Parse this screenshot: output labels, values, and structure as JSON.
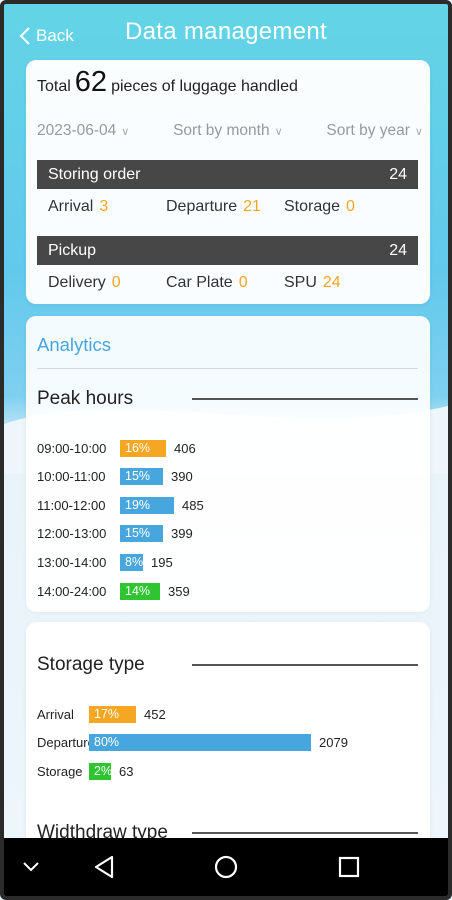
{
  "header": {
    "back_label": "Back",
    "title": "Data management"
  },
  "summary": {
    "total_prefix": "Total",
    "total_count": "62",
    "total_suffix": "pieces of luggage handled",
    "filters": {
      "date": "2023-06-04",
      "month": "Sort by month",
      "year": "Sort by year"
    },
    "storing_order": {
      "label": "Storing order",
      "count": "24",
      "stats": [
        {
          "label": "Arrival",
          "value": "3"
        },
        {
          "label": "Departure",
          "value": "21"
        },
        {
          "label": "Storage",
          "value": "0"
        }
      ]
    },
    "pickup": {
      "label": "Pickup",
      "count": "24",
      "stats": [
        {
          "label": "Delivery",
          "value": "0"
        },
        {
          "label": "Car Plate",
          "value": "0"
        },
        {
          "label": "SPU",
          "value": "24"
        }
      ]
    }
  },
  "analytics": {
    "heading": "Analytics",
    "peak_hours": {
      "title": "Peak hours",
      "rows": [
        {
          "label": "09:00-10:00",
          "percent": "16%",
          "fraction": 0.16,
          "value": "406",
          "color": "#f5a623"
        },
        {
          "label": "10:00-11:00",
          "percent": "15%",
          "fraction": 0.15,
          "value": "390",
          "color": "#47a6de"
        },
        {
          "label": "11:00-12:00",
          "percent": "19%",
          "fraction": 0.19,
          "value": "485",
          "color": "#47a6de"
        },
        {
          "label": "12:00-13:00",
          "percent": "15%",
          "fraction": 0.15,
          "value": "399",
          "color": "#47a6de"
        },
        {
          "label": "13:00-14:00",
          "percent": "8%",
          "fraction": 0.08,
          "value": "195",
          "color": "#47a6de"
        },
        {
          "label": "14:00-24:00",
          "percent": "14%",
          "fraction": 0.14,
          "value": "359",
          "color": "#2ec531"
        }
      ]
    },
    "storage_type": {
      "title": "Storage type",
      "rows": [
        {
          "label": "Arrival",
          "percent": "17%",
          "fraction": 0.17,
          "value": "452",
          "color": "#f5a623"
        },
        {
          "label": "Departure",
          "percent": "80%",
          "fraction": 0.8,
          "value": "2079",
          "color": "#47a6de"
        },
        {
          "label": "Storage",
          "percent": "2%",
          "fraction": 0.02,
          "value": "63",
          "color": "#2ec531"
        }
      ]
    },
    "withdraw_type": {
      "title": "Widthdraw type"
    }
  },
  "navbar": {
    "icons": [
      "chevron-down-icon",
      "back-triangle-icon",
      "home-circle-icon",
      "recents-square-icon"
    ]
  }
}
